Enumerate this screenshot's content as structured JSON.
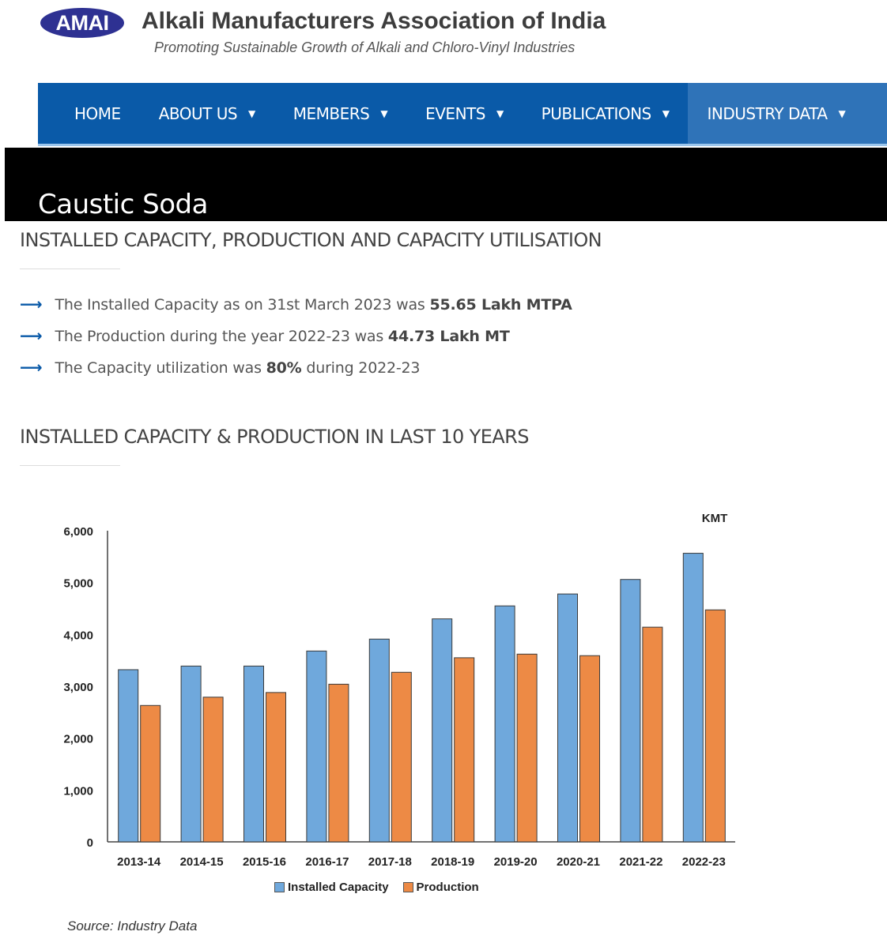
{
  "header": {
    "logo_text": "AMAI",
    "title": "Alkali Manufacturers  Association of India",
    "tagline": "Promoting Sustainable Growth of Alkali and Chloro-Vinyl Industries"
  },
  "nav": {
    "items": [
      {
        "label": "HOME"
      },
      {
        "label": "ABOUT US"
      },
      {
        "label": "MEMBERS"
      },
      {
        "label": "EVENTS"
      },
      {
        "label": "PUBLICATIONS"
      },
      {
        "label": "INDUSTRY DATA"
      }
    ],
    "caret": "▼"
  },
  "banner": {
    "title": "Caustic Soda"
  },
  "section1": {
    "heading": "INSTALLED CAPACITY, PRODUCTION AND CAPACITY UTILISATION",
    "bullets": [
      {
        "pre": "The Installed Capacity as on 31st March 2023 was ",
        "bold": "55.65 Lakh MTPA",
        "post": ""
      },
      {
        "pre": "The Production during the year 2022-23 was ",
        "bold": "44.73 Lakh MT",
        "post": ""
      },
      {
        "pre": "The Capacity utilization was ",
        "bold": "80%",
        "post": " during 2022-23"
      }
    ],
    "arrow": "⟶"
  },
  "section2": {
    "heading": "INSTALLED CAPACITY & PRODUCTION IN LAST 10 YEARS"
  },
  "chart_data": {
    "type": "bar",
    "unit_label": "KMT",
    "categories": [
      "2013-14",
      "2014-15",
      "2015-16",
      "2016-17",
      "2017-18",
      "2018-19",
      "2019-20",
      "2020-21",
      "2021-22",
      "2022-23"
    ],
    "series": [
      {
        "name": "Installed Capacity",
        "color": "#6fa8dc",
        "values": [
          3320,
          3390,
          3390,
          3680,
          3910,
          4300,
          4550,
          4780,
          5060,
          5565
        ]
      },
      {
        "name": "Production",
        "color": "#ed8a45",
        "values": [
          2630,
          2790,
          2880,
          3040,
          3270,
          3550,
          3620,
          3590,
          4140,
          4473
        ]
      }
    ],
    "ylim": [
      0,
      6000
    ],
    "yticks": [
      "0",
      "1,000",
      "2,000",
      "3,000",
      "4,000",
      "5,000",
      "6,000"
    ],
    "legend_position": "bottom",
    "grid": false
  },
  "source": "Source: Industry Data"
}
